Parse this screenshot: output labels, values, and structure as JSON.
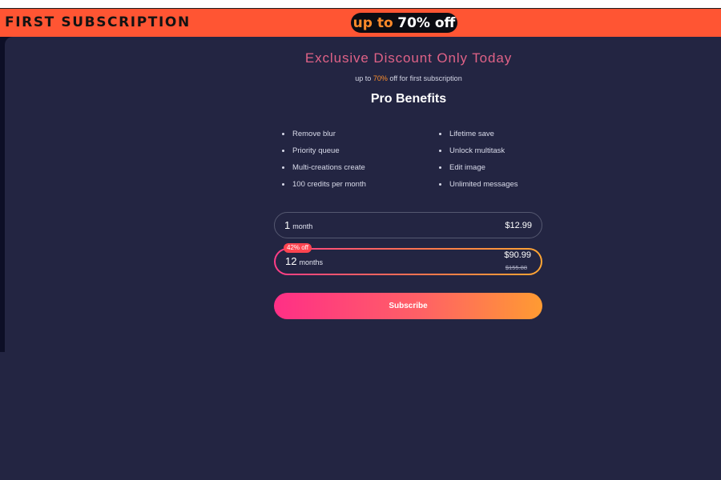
{
  "banner": {
    "title": "FIRST SUBSCRIPTION",
    "promo_prefix": "up to",
    "promo_value": "70% off"
  },
  "offer": {
    "heading": "Exclusive Discount Only Today",
    "sub_prefix": "up to ",
    "sub_percent": "70%",
    "sub_suffix": " off for first subscription"
  },
  "benefits": {
    "title": "Pro Benefits",
    "left": [
      "Remove blur",
      "Priority queue",
      "Multi-creations create",
      "100 credits per month"
    ],
    "right": [
      "Lifetime save",
      "Unlock multitask",
      "Edit image",
      "Unlimited messages"
    ]
  },
  "plans": [
    {
      "quantity": "1",
      "unit": "month",
      "price": "$12.99"
    },
    {
      "quantity": "12",
      "unit": "months",
      "price": "$90.99",
      "original_price": "$155.88",
      "badge": "42% off"
    }
  ],
  "subscribe_label": "Subscribe",
  "colors": {
    "background": "#232542",
    "banner": "#ff5533",
    "heading": "#e06287",
    "accent_orange": "#ff8f2c",
    "gradient_start": "#ff2f86",
    "gradient_end": "#ff9b32"
  }
}
